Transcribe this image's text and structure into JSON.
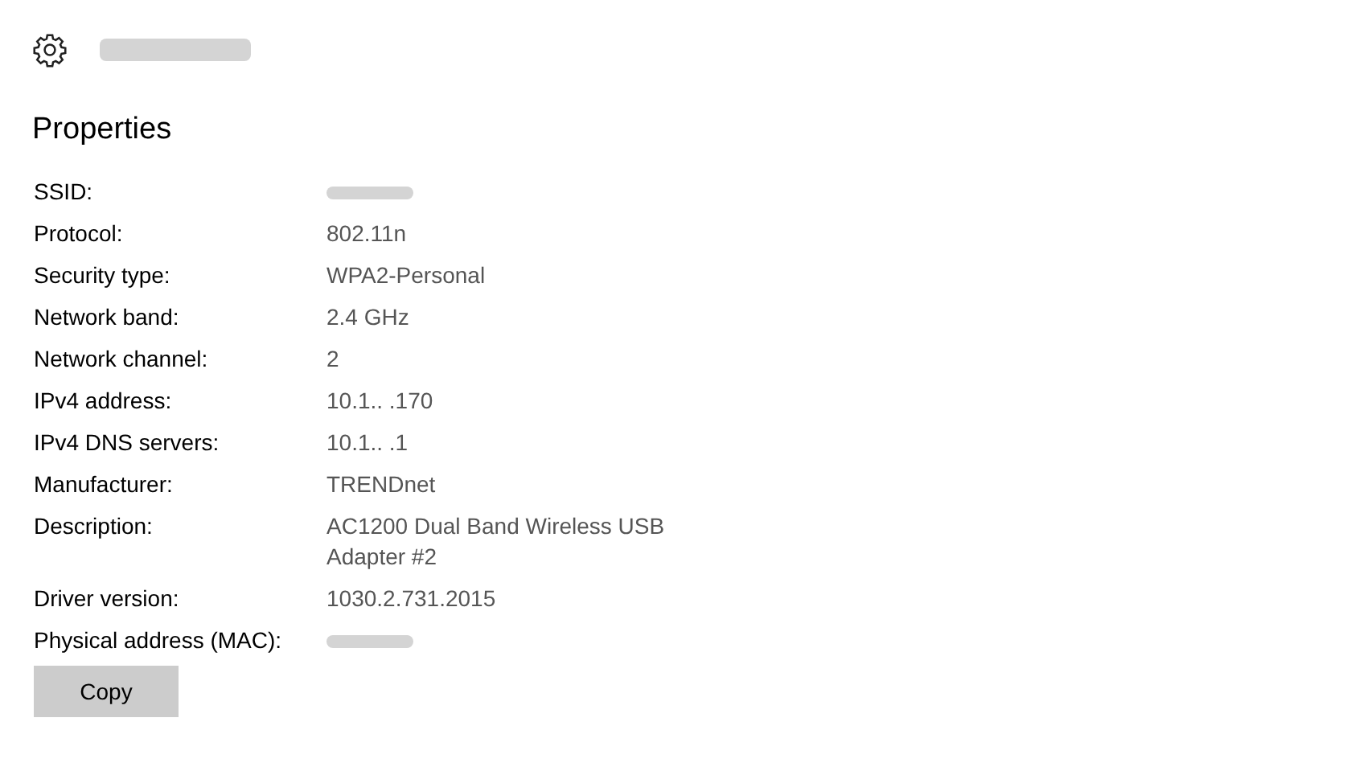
{
  "header": {
    "redacted": true
  },
  "section_title": "Properties",
  "properties": [
    {
      "label": "SSID:",
      "redacted": true
    },
    {
      "label": "Protocol:",
      "value": "802.11n",
      "redacted": false
    },
    {
      "label": "Security type:",
      "value": "WPA2-Personal",
      "redacted": false
    },
    {
      "label": "Network band:",
      "value": "2.4 GHz",
      "redacted": false
    },
    {
      "label": "Network channel:",
      "value": "2",
      "redacted": false
    },
    {
      "label": "IPv4 address:",
      "value": "10.1.. .170",
      "redacted": false
    },
    {
      "label": "IPv4 DNS servers:",
      "value": "10.1.. .1",
      "redacted": false
    },
    {
      "label": "Manufacturer:",
      "value": "TRENDnet",
      "redacted": false
    },
    {
      "label": "Description:",
      "value": "AC1200  Dual Band Wireless USB Adapter #2",
      "redacted": false
    },
    {
      "label": "Driver version:",
      "value": "1030.2.731.2015",
      "redacted": false
    },
    {
      "label": "Physical address (MAC):",
      "redacted": true
    }
  ],
  "button": "Copy"
}
